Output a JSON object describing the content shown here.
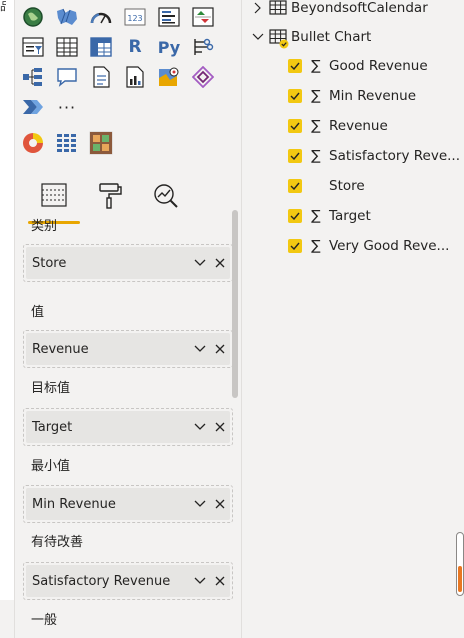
{
  "left_strip": {
    "glyph": "品"
  },
  "visualizations": {
    "icon_rows": [
      [
        "globe-map",
        "filled-map",
        "gauge",
        "card",
        "multi-row-card",
        "kpi"
      ],
      [
        "slicer",
        "table",
        "matrix",
        "r-visual",
        "python-visual",
        "key-influencers"
      ],
      [
        "decomposition-tree",
        "qa",
        "smart-narrative",
        "paginated-report",
        "azure-map",
        "power-apps"
      ],
      [
        "power-automate",
        "more-visuals"
      ]
    ],
    "r_label": "R",
    "py_label": "Py",
    "more_label": "···",
    "custom_icons": [
      "custom-donut",
      "custom-grid",
      "custom-bullet-chart"
    ],
    "tabs": [
      "fields-tab",
      "format-tab",
      "analytics-tab"
    ]
  },
  "wells": [
    {
      "label": "类别",
      "field": "Store"
    },
    {
      "label": "值",
      "field": "Revenue"
    },
    {
      "label": "目标值",
      "field": "Target"
    },
    {
      "label": "最小值",
      "field": "Min Revenue"
    },
    {
      "label": "有待改善",
      "field": "Satisfactory Revenue"
    },
    {
      "label": "一般",
      "field": ""
    }
  ],
  "fields": {
    "tables": [
      {
        "name": "BeyondsoftCalendar",
        "expanded": false
      },
      {
        "name": "Bullet Chart",
        "expanded": true
      }
    ],
    "items": [
      {
        "name": "Good Revenue",
        "sigma": true,
        "checked": true
      },
      {
        "name": "Min Revenue",
        "sigma": true,
        "checked": true
      },
      {
        "name": "Revenue",
        "sigma": true,
        "checked": true
      },
      {
        "name": "Satisfactory Reve...",
        "sigma": true,
        "checked": true
      },
      {
        "name": "Store",
        "sigma": false,
        "checked": true
      },
      {
        "name": "Target",
        "sigma": true,
        "checked": true
      },
      {
        "name": "Very Good Reve...",
        "sigma": true,
        "checked": true
      }
    ],
    "sigma_glyph": "∑"
  },
  "colors": {
    "accent": "#f2c811",
    "tab_underline": "#e8a600",
    "scroll_thumb": "#e87722"
  }
}
